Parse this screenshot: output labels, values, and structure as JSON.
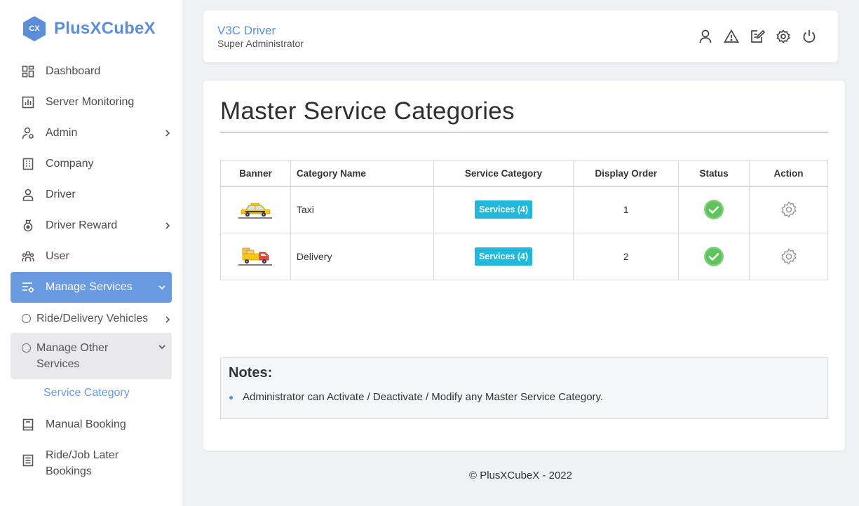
{
  "brand": {
    "logo_text": "CX",
    "name": "PlusXCubeX",
    "color": "#5b8dd9"
  },
  "sidebar": {
    "items": [
      {
        "label": "Dashboard",
        "icon": "dashboard-icon"
      },
      {
        "label": "Server Monitoring",
        "icon": "chart-icon"
      },
      {
        "label": "Admin",
        "icon": "admin-user-icon",
        "has_submenu": true
      },
      {
        "label": "Company",
        "icon": "building-icon"
      },
      {
        "label": "Driver",
        "icon": "driver-icon"
      },
      {
        "label": "Driver Reward",
        "icon": "medal-icon",
        "has_submenu": true
      },
      {
        "label": "User",
        "icon": "users-icon"
      },
      {
        "label": "Manage Services",
        "icon": "services-gear-icon",
        "active": true,
        "expanded": true
      },
      {
        "label": "Manual Booking",
        "icon": "book-icon"
      },
      {
        "label": "Ride/Job Later Bookings",
        "icon": "list-icon"
      }
    ],
    "manage_services_children": [
      {
        "label": "Ride/Delivery Vehicles",
        "has_submenu": true
      },
      {
        "label": "Manage Other Services",
        "expanded": true
      }
    ],
    "manage_other_children": [
      {
        "label": "Service Category",
        "active": true
      }
    ]
  },
  "header": {
    "title": "V3C Driver",
    "subtitle": "Super Administrator",
    "icons": [
      "profile-icon",
      "warning-icon",
      "edit-icon",
      "settings-icon",
      "power-icon"
    ]
  },
  "main": {
    "title": "Master Service Categories",
    "table": {
      "columns": [
        "Banner",
        "Category Name",
        "Service Category",
        "Display Order",
        "Status",
        "Action"
      ],
      "rows": [
        {
          "banner": "taxi-banner-icon",
          "name": "Taxi",
          "service": "Services (4)",
          "order": "1",
          "status": "active"
        },
        {
          "banner": "delivery-truck-banner-icon",
          "name": "Delivery",
          "service": "Services (4)",
          "order": "2",
          "status": "active"
        }
      ]
    },
    "notes": {
      "title": "Notes:",
      "items": [
        "Administrator can Activate / Deactivate / Modify any Master Service Category."
      ]
    }
  },
  "footer": {
    "text": "© PlusXCubeX - 2022"
  },
  "colors": {
    "accent": "#6a9be0",
    "badge": "#22b8dc",
    "status_active": "#5cc45a"
  }
}
